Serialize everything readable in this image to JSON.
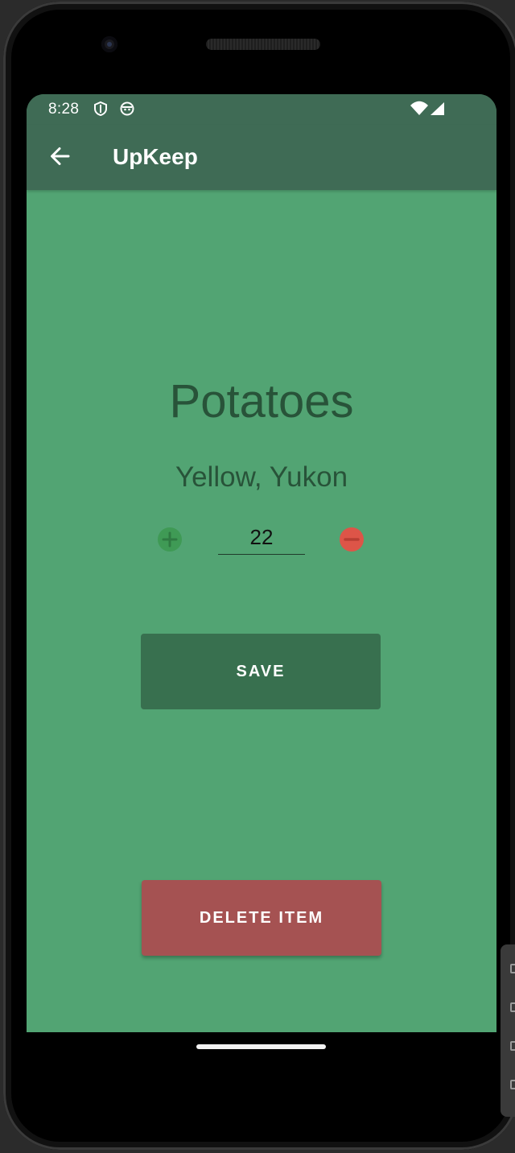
{
  "status_bar": {
    "time": "8:28",
    "icons": [
      "shield-icon",
      "face-icon",
      "wifi-icon",
      "signal-icon"
    ]
  },
  "app_bar": {
    "back_icon": "arrow-left-icon",
    "title": "UpKeep"
  },
  "item": {
    "name": "Potatoes",
    "variety": "Yellow, Yukon",
    "quantity": "22"
  },
  "controls": {
    "increment_icon": "plus-circle-icon",
    "decrement_icon": "minus-circle-icon",
    "save_label": "SAVE",
    "delete_label": "DELETE ITEM"
  },
  "colors": {
    "app_bar": "#3f6b55",
    "background": "#52a473",
    "text_dark": "#285339",
    "save": "#38704f",
    "delete": "#a55252",
    "increment": "#3f9a55",
    "decrement": "#dd5548"
  }
}
